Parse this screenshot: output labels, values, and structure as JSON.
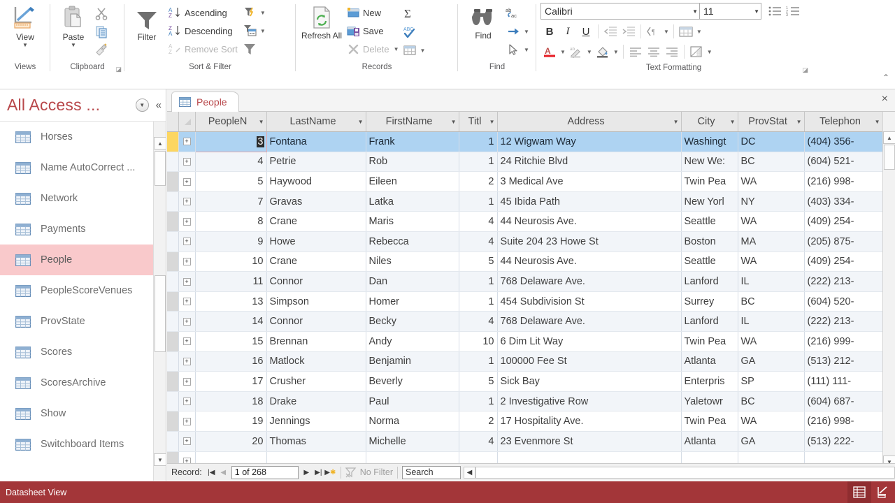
{
  "ribbon": {
    "groups": [
      {
        "name": "Views",
        "label": "Views",
        "items": [
          {
            "label": "View",
            "icon": "view-design-icon"
          }
        ]
      },
      {
        "name": "Clipboard",
        "label": "Clipboard",
        "dialog_launcher": true,
        "items": [
          {
            "label": "Paste",
            "icon": "paste-icon"
          },
          {
            "label": "Cut",
            "icon": "scissors-icon"
          },
          {
            "label": "Copy",
            "icon": "copy-icon"
          },
          {
            "label": "Format Painter",
            "icon": "format-painter-icon"
          }
        ]
      },
      {
        "name": "Sort & Filter",
        "label": "Sort & Filter",
        "items": [
          {
            "label": "Filter",
            "icon": "funnel-icon"
          },
          {
            "label": "Ascending",
            "icon": "sort-az-icon"
          },
          {
            "label": "Descending",
            "icon": "sort-za-icon"
          },
          {
            "label": "Remove Sort",
            "icon": "remove-sort-icon",
            "disabled": true
          },
          {
            "label": "Selection",
            "icon": "filter-selection-icon"
          },
          {
            "label": "Advanced",
            "icon": "filter-advanced-icon"
          },
          {
            "label": "Toggle Filter",
            "icon": "toggle-filter-icon"
          }
        ]
      },
      {
        "name": "Records",
        "label": "Records",
        "items": [
          {
            "label": "Refresh All",
            "icon": "refresh-all-icon"
          },
          {
            "label": "New",
            "icon": "new-record-icon"
          },
          {
            "label": "Save",
            "icon": "save-record-icon"
          },
          {
            "label": "Delete",
            "icon": "delete-record-icon",
            "disabled": true
          },
          {
            "label": "Totals",
            "icon": "sigma-icon"
          },
          {
            "label": "Spelling",
            "icon": "spelling-icon"
          },
          {
            "label": "More",
            "icon": "more-records-icon"
          }
        ]
      },
      {
        "name": "Find",
        "label": "Find",
        "items": [
          {
            "label": "Find",
            "icon": "binoculars-icon"
          },
          {
            "label": "Replace",
            "icon": "replace-icon"
          },
          {
            "label": "Go To",
            "icon": "goto-arrow-icon"
          },
          {
            "label": "Select",
            "icon": "select-cursor-icon"
          }
        ]
      },
      {
        "name": "Text Formatting",
        "label": "Text Formatting",
        "dialog_launcher": true,
        "font_name": "Calibri",
        "font_size": "11",
        "items": [
          {
            "label": "Bullets",
            "icon": "bullets-icon"
          },
          {
            "label": "Numbering",
            "icon": "numbering-icon"
          },
          {
            "label": "Bold",
            "icon": "bold-icon"
          },
          {
            "label": "Italic",
            "icon": "italic-icon"
          },
          {
            "label": "Underline",
            "icon": "underline-icon"
          },
          {
            "label": "Decrease Indent",
            "icon": "decrease-indent-icon"
          },
          {
            "label": "Increase Indent",
            "icon": "increase-indent-icon"
          },
          {
            "label": "Text Direction",
            "icon": "text-direction-icon"
          },
          {
            "label": "Gridlines",
            "icon": "table-gridlines-icon"
          },
          {
            "label": "Font Color",
            "icon": "font-color-icon"
          },
          {
            "label": "Text Highlight Color",
            "icon": "highlight-color-icon"
          },
          {
            "label": "Background Color",
            "icon": "fill-color-icon"
          },
          {
            "label": "Align Left",
            "icon": "align-left-icon"
          },
          {
            "label": "Center",
            "icon": "align-center-icon"
          },
          {
            "label": "Align Right",
            "icon": "align-right-icon"
          },
          {
            "label": "Alternate Row Color",
            "icon": "alternate-row-color-icon"
          }
        ]
      }
    ],
    "collapse_label": "Collapse the Ribbon"
  },
  "navpane": {
    "title": "All Access ...",
    "dropdown_icon": "chevron-down-circle-icon",
    "collapse_icon": "double-chevron-left-icon",
    "items": [
      {
        "label": "Horses",
        "icon": "table-icon"
      },
      {
        "label": "Name AutoCorrect ...",
        "icon": "table-icon"
      },
      {
        "label": "Network",
        "icon": "table-icon"
      },
      {
        "label": "Payments",
        "icon": "table-icon"
      },
      {
        "label": "People",
        "icon": "table-icon",
        "selected": true
      },
      {
        "label": "PeopleScoreVenues",
        "icon": "table-icon"
      },
      {
        "label": "ProvState",
        "icon": "table-icon"
      },
      {
        "label": "Scores",
        "icon": "table-icon"
      },
      {
        "label": "ScoresArchive",
        "icon": "table-icon"
      },
      {
        "label": "Show",
        "icon": "table-icon"
      },
      {
        "label": "Switchboard Items",
        "icon": "table-icon"
      }
    ]
  },
  "document": {
    "tab_label": "People",
    "tab_icon": "table-icon",
    "close_icon": "close-icon"
  },
  "grid": {
    "columns": [
      {
        "key": "PeopleN",
        "label": "PeopleN",
        "active": true,
        "align": "right"
      },
      {
        "key": "LastName",
        "label": "LastName",
        "align": "left"
      },
      {
        "key": "FirstName",
        "label": "FirstName",
        "align": "left"
      },
      {
        "key": "Titl",
        "label": "Titl",
        "align": "right"
      },
      {
        "key": "Address",
        "label": "Address",
        "align": "left"
      },
      {
        "key": "City",
        "label": "City",
        "align": "left"
      },
      {
        "key": "ProvStat",
        "label": "ProvStat",
        "align": "left"
      },
      {
        "key": "Telephon",
        "label": "Telephon",
        "align": "left"
      }
    ],
    "editing_cell": {
      "row": 0,
      "column": "PeopleN",
      "value": "3"
    },
    "rows": [
      {
        "PeopleN": "3",
        "LastName": "Fontana",
        "FirstName": "Frank",
        "Titl": "1",
        "Address": "12 Wigwam Way",
        "City": "Washingt",
        "ProvStat": "DC",
        "Telephon": "(404) 356-",
        "selected": true
      },
      {
        "PeopleN": "4",
        "LastName": "Petrie",
        "FirstName": "Rob",
        "Titl": "1",
        "Address": "24 Ritchie Blvd",
        "City": "New We:",
        "ProvStat": "BC",
        "Telephon": "(604) 521-"
      },
      {
        "PeopleN": "5",
        "LastName": "Haywood",
        "FirstName": "Eileen",
        "Titl": "2",
        "Address": "3 Medical Ave",
        "City": "Twin Pea",
        "ProvStat": "WA",
        "Telephon": "(216) 998-"
      },
      {
        "PeopleN": "7",
        "LastName": "Gravas",
        "FirstName": "Latka",
        "Titl": "1",
        "Address": "45 Ibida Path",
        "City": "New Yorl",
        "ProvStat": "NY",
        "Telephon": "(403) 334-"
      },
      {
        "PeopleN": "8",
        "LastName": "Crane",
        "FirstName": "Maris",
        "Titl": "4",
        "Address": "44 Neurosis Ave.",
        "City": "Seattle",
        "ProvStat": "WA",
        "Telephon": "(409) 254-"
      },
      {
        "PeopleN": "9",
        "LastName": "Howe",
        "FirstName": "Rebecca",
        "Titl": "4",
        "Address": "Suite 204 23 Howe St",
        "City": "Boston",
        "ProvStat": "MA",
        "Telephon": "(205) 875-"
      },
      {
        "PeopleN": "10",
        "LastName": "Crane",
        "FirstName": "Niles",
        "Titl": "5",
        "Address": "44 Neurosis Ave.",
        "City": "Seattle",
        "ProvStat": "WA",
        "Telephon": "(409) 254-"
      },
      {
        "PeopleN": "11",
        "LastName": "Connor",
        "FirstName": "Dan",
        "Titl": "1",
        "Address": "768 Delaware Ave.",
        "City": "Lanford",
        "ProvStat": "IL",
        "Telephon": "(222) 213-"
      },
      {
        "PeopleN": "13",
        "LastName": "Simpson",
        "FirstName": "Homer",
        "Titl": "1",
        "Address": "454 Subdivision St",
        "City": "Surrey",
        "ProvStat": "BC",
        "Telephon": "(604) 520-"
      },
      {
        "PeopleN": "14",
        "LastName": "Connor",
        "FirstName": "Becky",
        "Titl": "4",
        "Address": "768 Delaware Ave.",
        "City": "Lanford",
        "ProvStat": "IL",
        "Telephon": "(222) 213-"
      },
      {
        "PeopleN": "15",
        "LastName": "Brennan",
        "FirstName": "Andy",
        "Titl": "10",
        "Address": "6 Dim Lit Way",
        "City": "Twin Pea",
        "ProvStat": "WA",
        "Telephon": "(216) 999-"
      },
      {
        "PeopleN": "16",
        "LastName": "Matlock",
        "FirstName": "Benjamin",
        "Titl": "1",
        "Address": "100000 Fee St",
        "City": "Atlanta",
        "ProvStat": "GA",
        "Telephon": "(513) 212-"
      },
      {
        "PeopleN": "17",
        "LastName": "Crusher",
        "FirstName": "Beverly",
        "Titl": "5",
        "Address": "Sick Bay",
        "City": "Enterpris",
        "ProvStat": "SP",
        "Telephon": "(111) 111-"
      },
      {
        "PeopleN": "18",
        "LastName": "Drake",
        "FirstName": "Paul",
        "Titl": "1",
        "Address": "2 Investigative Row",
        "City": "Yaletowr",
        "ProvStat": "BC",
        "Telephon": "(604) 687-"
      },
      {
        "PeopleN": "19",
        "LastName": "Jennings",
        "FirstName": "Norma",
        "Titl": "2",
        "Address": "17 Hospitality Ave.",
        "City": "Twin Pea",
        "ProvStat": "WA",
        "Telephon": "(216) 998-"
      },
      {
        "PeopleN": "20",
        "LastName": "Thomas",
        "FirstName": "Michelle",
        "Titl": "4",
        "Address": "23 Evenmore St",
        "City": "Atlanta",
        "ProvStat": "GA",
        "Telephon": "(513) 222-"
      }
    ],
    "expand_glyph": "+"
  },
  "recordnav": {
    "label": "Record:",
    "first_icon": "first-record-icon",
    "prev_icon": "previous-record-icon",
    "position": "1 of 268",
    "next_icon": "next-record-icon",
    "last_icon": "last-record-icon",
    "new_icon": "new-record-icon",
    "filter_status": "No Filter",
    "filter_icon": "no-filter-icon",
    "search_label": "Search"
  },
  "statusbar": {
    "text": "Datasheet View",
    "views": [
      {
        "name": "datasheet-view",
        "icon": "datasheet-view-icon",
        "active": true
      },
      {
        "name": "design-view",
        "icon": "design-view-icon",
        "active": false
      }
    ]
  }
}
